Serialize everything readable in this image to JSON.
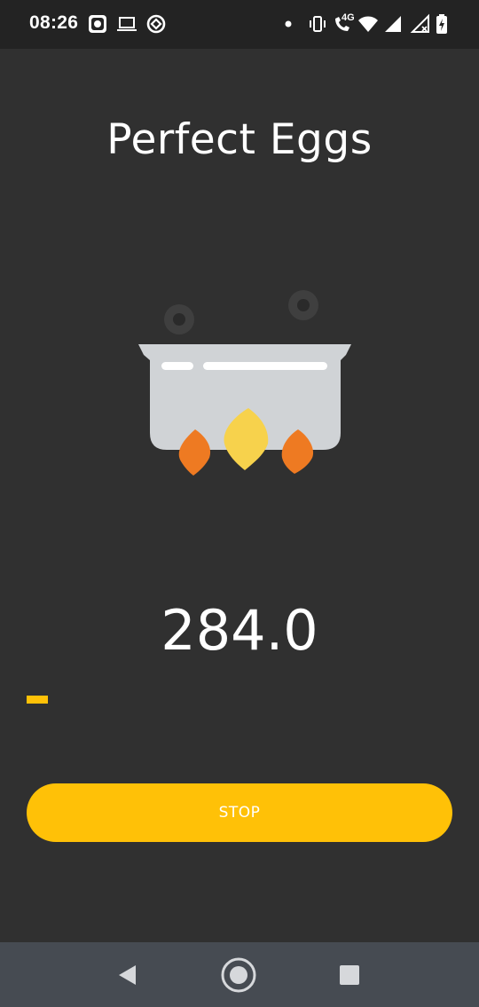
{
  "status_bar": {
    "time": "08:26",
    "left_icons": [
      "notification-app-icon",
      "laptop-icon",
      "vpn-icon"
    ],
    "right_icons": [
      "dot-icon",
      "vibrate-icon",
      "volte-call-icon",
      "wifi-icon",
      "signal-icon",
      "signal-no-sim-icon",
      "battery-charging-icon"
    ],
    "network_label": "4G"
  },
  "app": {
    "title": "Perfect Eggs",
    "timer": "284.0",
    "progress_fraction": 0.05,
    "stop_label": "STOP"
  },
  "colors": {
    "background": "#303030",
    "accent": "#FFC107",
    "status_bar": "#232323",
    "nav_bar": "#464B52",
    "pot": "#D0D3D6",
    "flame_orange": "#EE7A22",
    "flame_yellow": "#F7D24C"
  },
  "nav_bar": {
    "buttons": [
      "back-icon",
      "home-icon",
      "recents-icon"
    ]
  }
}
